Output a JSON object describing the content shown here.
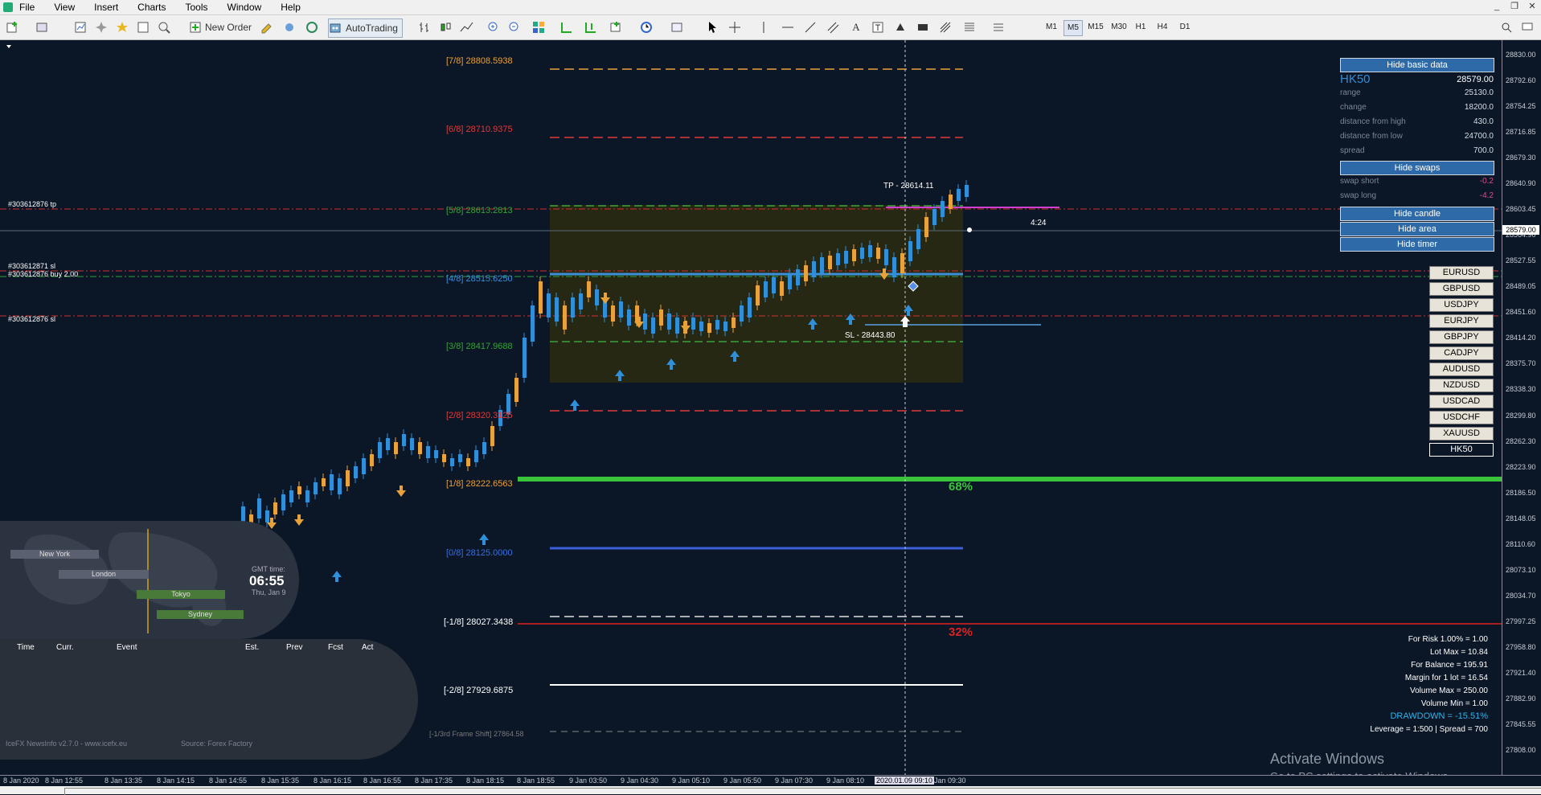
{
  "menu": [
    "File",
    "View",
    "Insert",
    "Charts",
    "Tools",
    "Window",
    "Help"
  ],
  "window_controls": [
    "_",
    "❐",
    "✕"
  ],
  "toolbar": {
    "new_order": "New Order",
    "autotrading": "AutoTrading",
    "timeframes": [
      "M1",
      "M5",
      "M15",
      "M30",
      "H1",
      "H4",
      "D1"
    ],
    "active_timeframe": "M5"
  },
  "price_axis": [
    "28830.00",
    "28792.60",
    "28754.25",
    "28716.85",
    "28679.30",
    "28640.90",
    "28603.45",
    "28564.90",
    "28527.55",
    "28489.05",
    "28451.60",
    "28414.20",
    "28375.70",
    "28338.30",
    "28299.80",
    "28262.30",
    "28223.90",
    "28186.50",
    "28148.05",
    "28110.60",
    "28073.10",
    "28034.70",
    "27997.25",
    "27958.80",
    "27921.40",
    "27882.90",
    "27845.55",
    "27808.00"
  ],
  "current_price_tag": "28579.00",
  "time_axis": [
    "8 Jan 2020",
    "8 Jan 12:55",
    "8 Jan 13:35",
    "8 Jan 14:15",
    "8 Jan 14:55",
    "8 Jan 15:35",
    "8 Jan 16:15",
    "8 Jan 16:55",
    "8 Jan 17:35",
    "8 Jan 18:15",
    "8 Jan 18:55",
    "9 Jan 03:50",
    "9 Jan 04:30",
    "9 Jan 05:10",
    "9 Jan 05:50",
    "9 Jan 07:30",
    "9 Jan 08:10",
    "2020.01.09 09:10",
    "Jan 09:30"
  ],
  "murrey_levels": [
    {
      "tag": "[7/8]",
      "value": "28808.5938",
      "color": "#e8a23a"
    },
    {
      "tag": "[6/8]",
      "value": "28710.9375",
      "color": "#e03a3a"
    },
    {
      "tag": "[5/8]",
      "value": "28613.2813",
      "color": "#3aa03a"
    },
    {
      "tag": "[4/8]",
      "value": "28515.6250",
      "color": "#3a8fd8"
    },
    {
      "tag": "[3/8]",
      "value": "28417.9688",
      "color": "#3aa03a"
    },
    {
      "tag": "[2/8]",
      "value": "28320.3125",
      "color": "#e03a3a"
    },
    {
      "tag": "[1/8]",
      "value": "28222.6563",
      "color": "#e8a23a"
    },
    {
      "tag": "[0/8]",
      "value": "28125.0000",
      "color": "#3a6fd8"
    },
    {
      "tag": "[-1/8]",
      "value": "28027.3438",
      "color": "#ffffff"
    },
    {
      "tag": "[-2/8]",
      "value": "27929.6875",
      "color": "#ffffff"
    }
  ],
  "frame_shift": "[-1/3rd Frame Shift]  27864.58",
  "order_labels": {
    "tp": "#303612876 tp",
    "sl1": "#303612871 sl",
    "buy": "#303612876 buy 2.00",
    "sl2": "#303612876 sl"
  },
  "trade": {
    "tp": "TP - 28614.11",
    "sl": "SL - 28443.80",
    "timer": "4:24"
  },
  "percent": {
    "upper": "68%",
    "lower": "32%"
  },
  "info_panel": {
    "hide_basic": "Hide basic data",
    "symbol": "HK50",
    "price": "28579.00",
    "rows": [
      {
        "label": "range",
        "value": "25130.0"
      },
      {
        "label": "change",
        "value": "18200.0"
      },
      {
        "label": "distance from high",
        "value": "430.0"
      },
      {
        "label": "distance from low",
        "value": "24700.0"
      },
      {
        "label": "spread",
        "value": "700.0"
      }
    ],
    "hide_swaps": "Hide swaps",
    "swaps": [
      {
        "label": "swap short",
        "value": "-0.2"
      },
      {
        "label": "swap long",
        "value": "-4.2"
      }
    ],
    "buttons": [
      "Hide candle",
      "Hide area",
      "Hide timer"
    ]
  },
  "symbols": [
    "EURUSD",
    "GBPUSD",
    "USDJPY",
    "EURJPY",
    "GBPJPY",
    "CADJPY",
    "AUDUSD",
    "NZDUSD",
    "USDCAD",
    "USDCHF",
    "XAUUSD",
    "HK50"
  ],
  "risk": [
    "For Risk 1.00% = 1.00",
    "Lot Max = 10.84",
    "For Balance = 195.91",
    "Margin for 1 lot = 16.54",
    "Volume Max = 250.00",
    "Volume Min = 1.00",
    "DRAWDOWN = -15.51%",
    "Leverage = 1:500 | Spread = 700"
  ],
  "news": {
    "sessions": [
      "New York",
      "London",
      "Tokyo",
      "Sydney"
    ],
    "gmt_label": "GMT time:",
    "gmt_time": "06:55",
    "gmt_date": "Thu, Jan 9",
    "columns": [
      "Time",
      "Curr.",
      "Event",
      "Est.",
      "Prev",
      "Fcst",
      "Act"
    ],
    "version": "IceFX NewsInfo v2.7.0  -  www.icefx.eu",
    "source": "Source: Forex Factory"
  },
  "watermark": {
    "line1": "Activate Windows",
    "line2": "Go to PC settings to activate Windows."
  },
  "colors": {
    "bg": "#0b1626",
    "bull": "#2f8fd8",
    "bear": "#e8a23a",
    "green": "#3ac43a",
    "red": "#e02020",
    "panel_btn": "#2e6aa8"
  }
}
